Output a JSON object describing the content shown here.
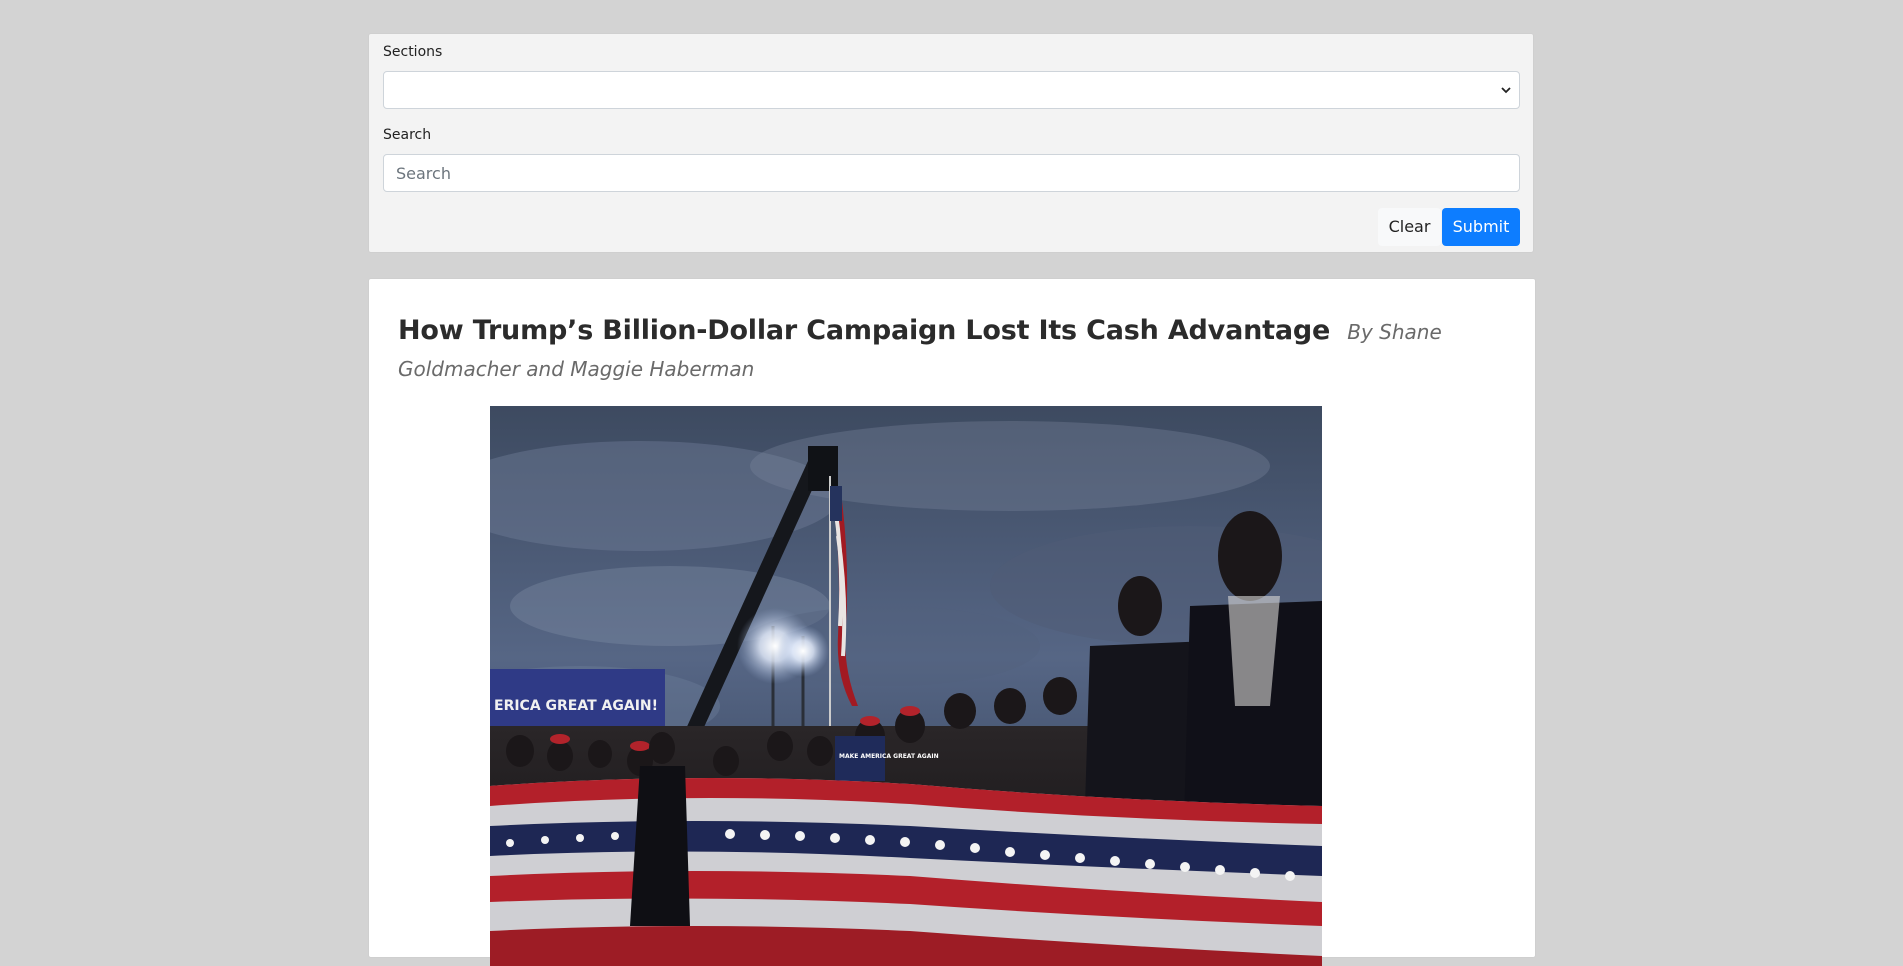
{
  "filters": {
    "sections_label": "Sections",
    "sections_value": "",
    "search_label": "Search",
    "search_placeholder": "Search",
    "search_value": "",
    "clear_label": "Clear",
    "submit_label": "Submit"
  },
  "article": {
    "title": "How Trump’s Billion-Dollar Campaign Lost Its Cash Advantage",
    "byline": "By Shane Goldmacher and Maggie Haberman",
    "image": {
      "banner_text": "ERICA GREAT AGAIN!",
      "sign_text": "MAKE AMERICA GREAT AGAIN"
    }
  },
  "colors": {
    "page_background": "#d3d3d3",
    "submit_blue": "#0d7dff",
    "panel_background": "#f3f3f3"
  }
}
